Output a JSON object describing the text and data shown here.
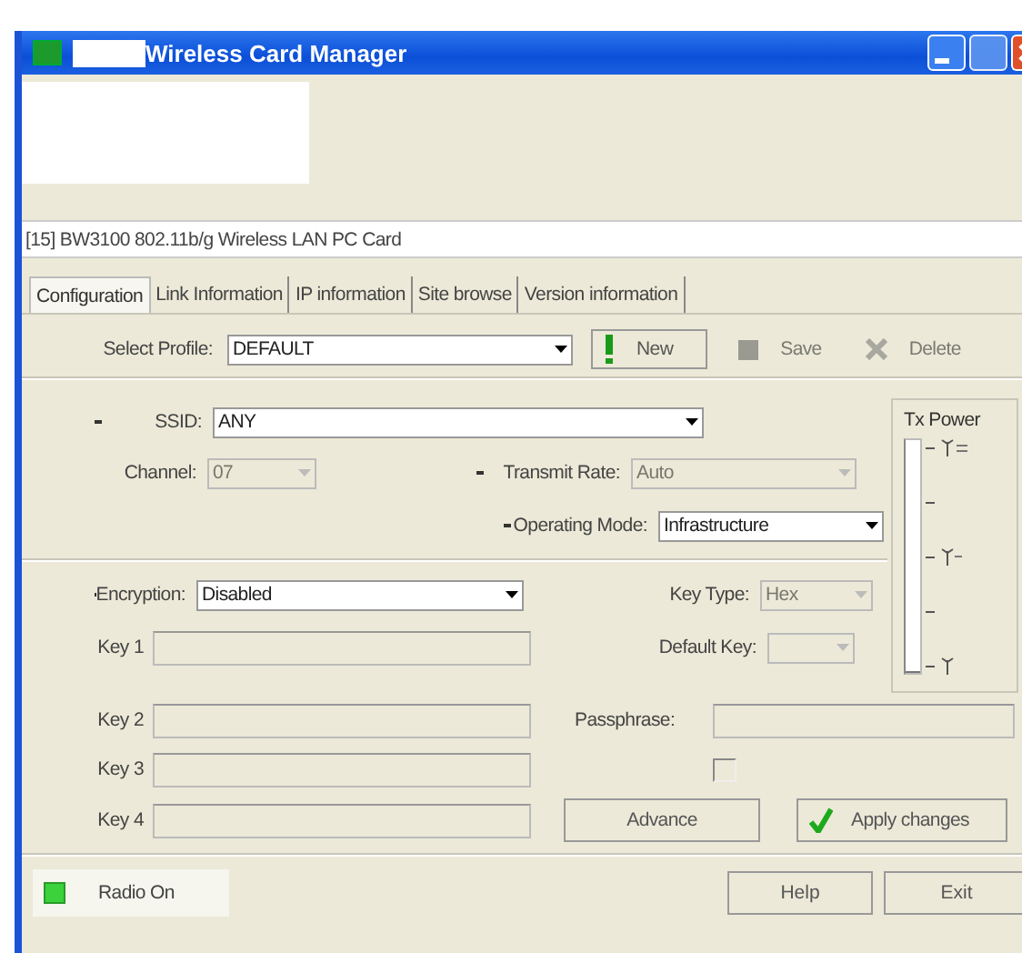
{
  "window": {
    "title": "Wireless Card Manager"
  },
  "adapter": {
    "value": "[15] BW3100 802.11b/g Wireless LAN PC Card"
  },
  "tabs": [
    {
      "label": "Configuration",
      "selected": true
    },
    {
      "label": "Link Information",
      "selected": false
    },
    {
      "label": "IP information",
      "selected": false
    },
    {
      "label": "Site browse",
      "selected": false
    },
    {
      "label": "Version information",
      "selected": false
    }
  ],
  "profile": {
    "label": "Select Profile:",
    "value": "DEFAULT",
    "disabled": false
  },
  "profile_buttons": [
    {
      "label": "New",
      "kind": "new",
      "disabled": false
    },
    {
      "label": "Save",
      "kind": "save",
      "disabled": true
    },
    {
      "label": "Delete",
      "kind": "delete",
      "disabled": true
    }
  ],
  "ssid": {
    "label": "SSID:",
    "value": "ANY",
    "required": true,
    "disabled": false
  },
  "channel": {
    "label": "Channel:",
    "value": "07",
    "disabled": true
  },
  "transmit_rate": {
    "label": "Transmit Rate:",
    "value": "Auto",
    "required": true,
    "disabled": true
  },
  "operating_mode": {
    "label": "Operating Mode:",
    "value": "Infrastructure",
    "required": true,
    "disabled": false
  },
  "encryption": {
    "label": "Encryption:",
    "value": "Disabled",
    "required": true,
    "disabled": false
  },
  "key_type": {
    "label": "Key Type:",
    "value": "Hex",
    "disabled": true
  },
  "default_key": {
    "label": "Default Key:",
    "disabled": true
  },
  "keys": [
    {
      "label": "Key 1"
    },
    {
      "label": "Key 2"
    },
    {
      "label": "Key 3"
    },
    {
      "label": "Key 4"
    }
  ],
  "passphrase": {
    "label": "Passphrase:"
  },
  "passphrase_option": {
    "checked": false
  },
  "tx_power": {
    "label": "Tx Power",
    "level": 0
  },
  "actions": [
    {
      "label": "Advance",
      "kind": "plain"
    },
    {
      "label": "Apply changes",
      "kind": "apply"
    }
  ],
  "status": {
    "label": "Radio On",
    "on": true
  },
  "footer_buttons": [
    "Help",
    "Exit"
  ]
}
